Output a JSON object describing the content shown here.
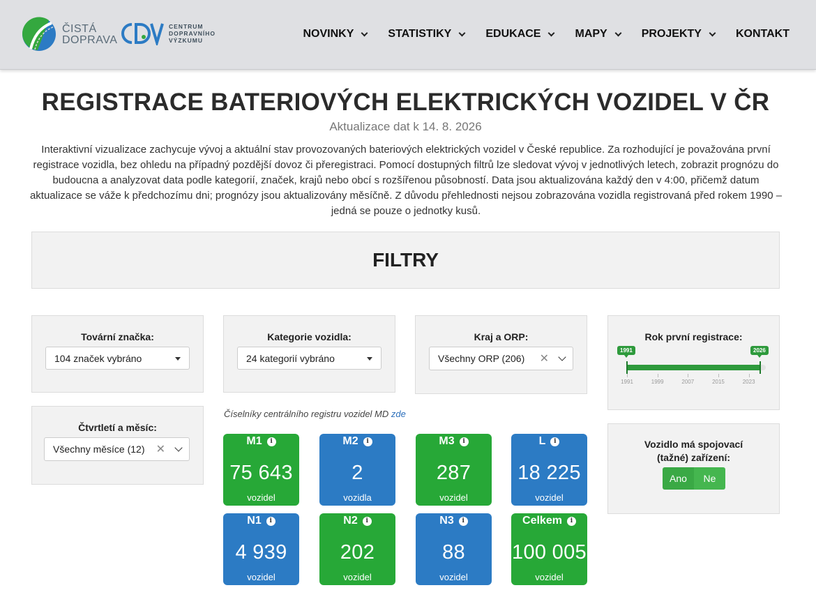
{
  "header": {
    "logo_cd_line1": "ČISTÁ",
    "logo_cd_line2": "DOPRAVA",
    "logo_cdv_mark": "CDV",
    "logo_cdv_line1": "CENTRUM",
    "logo_cdv_line2": "DOPRAVNÍHO",
    "logo_cdv_line3": "VÝZKUMU",
    "nav": [
      {
        "label": "NOVINKY",
        "dropdown": true
      },
      {
        "label": "STATISTIKY",
        "dropdown": true
      },
      {
        "label": "EDUKACE",
        "dropdown": true
      },
      {
        "label": "MAPY",
        "dropdown": true
      },
      {
        "label": "PROJEKTY",
        "dropdown": true
      },
      {
        "label": "KONTAKT",
        "dropdown": false
      }
    ]
  },
  "page": {
    "title": "REGISTRACE BATERIOVÝCH ELEKTRICKÝCH VOZIDEL V ČR",
    "update": "Aktualizace dat k 14. 8. 2026",
    "intro": "Interaktivní vizualizace zachycuje vývoj a aktuální stav provozovaných bateriových elektrických vozidel v České republice. Za rozhodující je považována první registrace vozidla, bez ohledu na případný pozdější dovoz či přeregistraci. Pomocí dostupných filtrů lze sledovat vývoj v jednotlivých letech, zobrazit prognózu do budoucna a analyzovat data podle kategorií, značek, krajů nebo obcí s rozšířenou působností. Data jsou aktualizována každý den v 4:00, přičemž datum aktualizace se váže k předchozímu dni; prognózy jsou aktualizovány měsíčně. Z důvodu přehlednosti nejsou zobrazována vozidla registrovaná před rokem 1990 – jedná se pouze o jednotky kusů."
  },
  "filters": {
    "heading": "FILTRY",
    "brand": {
      "label": "Tovární značka:",
      "value": "104 značek vybráno"
    },
    "category": {
      "label": "Kategorie vozidla:",
      "value": "24 kategorií vybráno"
    },
    "region": {
      "label": "Kraj a ORP:",
      "value": "Všechny ORP (206)"
    },
    "quarter": {
      "label": "Čtvrtletí a měsíc:",
      "value": "Všechny měsíce (12)"
    },
    "year": {
      "label": "Rok první registrace:",
      "min": 1991,
      "max": 2026,
      "selected_from": "1991",
      "selected_to": "2026",
      "ticks": [
        "1991",
        "1999",
        "2007",
        "2015",
        "2023"
      ]
    },
    "towing": {
      "label": "Vozidlo má spojovací (tažné) zařízení:",
      "yes": "Ano",
      "no": "Ne"
    }
  },
  "codelist": {
    "text": "Číselníky centrálního registru vozidel MD ",
    "link": "zde"
  },
  "cards": [
    {
      "title": "M1",
      "value": "75 643",
      "unit": "vozidel",
      "color": "green"
    },
    {
      "title": "M2",
      "value": "2",
      "unit": "vozidla",
      "color": "blue"
    },
    {
      "title": "M3",
      "value": "287",
      "unit": "vozidel",
      "color": "green"
    },
    {
      "title": "L",
      "value": "18 225",
      "unit": "vozidel",
      "color": "blue"
    },
    {
      "title": "N1",
      "value": "4 939",
      "unit": "vozidel",
      "color": "blue"
    },
    {
      "title": "N2",
      "value": "202",
      "unit": "vozidel",
      "color": "green"
    },
    {
      "title": "N3",
      "value": "88",
      "unit": "vozidel",
      "color": "blue"
    },
    {
      "title": "Celkem",
      "value": "100 005",
      "unit": "vozidel",
      "color": "green"
    }
  ],
  "colors": {
    "green": "#27a837",
    "blue": "#2c7bc4",
    "panel_bg": "#f2f2f2",
    "header_bg": "#dfe0e3"
  }
}
